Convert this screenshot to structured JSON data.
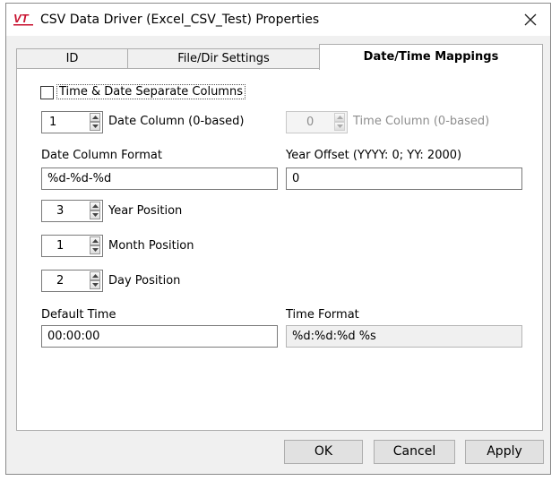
{
  "window": {
    "title": "CSV Data Driver (Excel_CSV_Test) Properties",
    "logo_text": "VT"
  },
  "tabs": [
    {
      "label": "ID",
      "active": false
    },
    {
      "label": "File/Dir Settings",
      "active": false
    },
    {
      "label": "Date/Time Mappings",
      "active": true
    }
  ],
  "form": {
    "separate_columns": {
      "label": "Time & Date Separate Columns",
      "checked": false
    },
    "date_column": {
      "value": "1",
      "label": "Date Column (0-based)"
    },
    "time_column": {
      "value": "0",
      "label": "Time Column (0-based)",
      "disabled": true
    },
    "date_format": {
      "label": "Date Column Format",
      "value": "%d-%d-%d"
    },
    "year_offset": {
      "label": "Year Offset (YYYY: 0; YY: 2000)",
      "value": "0"
    },
    "year_position": {
      "value": "3",
      "label": "Year Position"
    },
    "month_position": {
      "value": "1",
      "label": "Month Position"
    },
    "day_position": {
      "value": "2",
      "label": "Day Position"
    },
    "default_time": {
      "label": "Default Time",
      "value": "00:00:00"
    },
    "time_format": {
      "label": "Time Format",
      "value": "%d:%d:%d %s"
    }
  },
  "buttons": {
    "ok": "OK",
    "cancel": "Cancel",
    "apply": "Apply"
  },
  "colors": {
    "logo_red": "#c8102e",
    "dialog_bg": "#f0f0f0",
    "button_bg": "#e1e1e1"
  }
}
